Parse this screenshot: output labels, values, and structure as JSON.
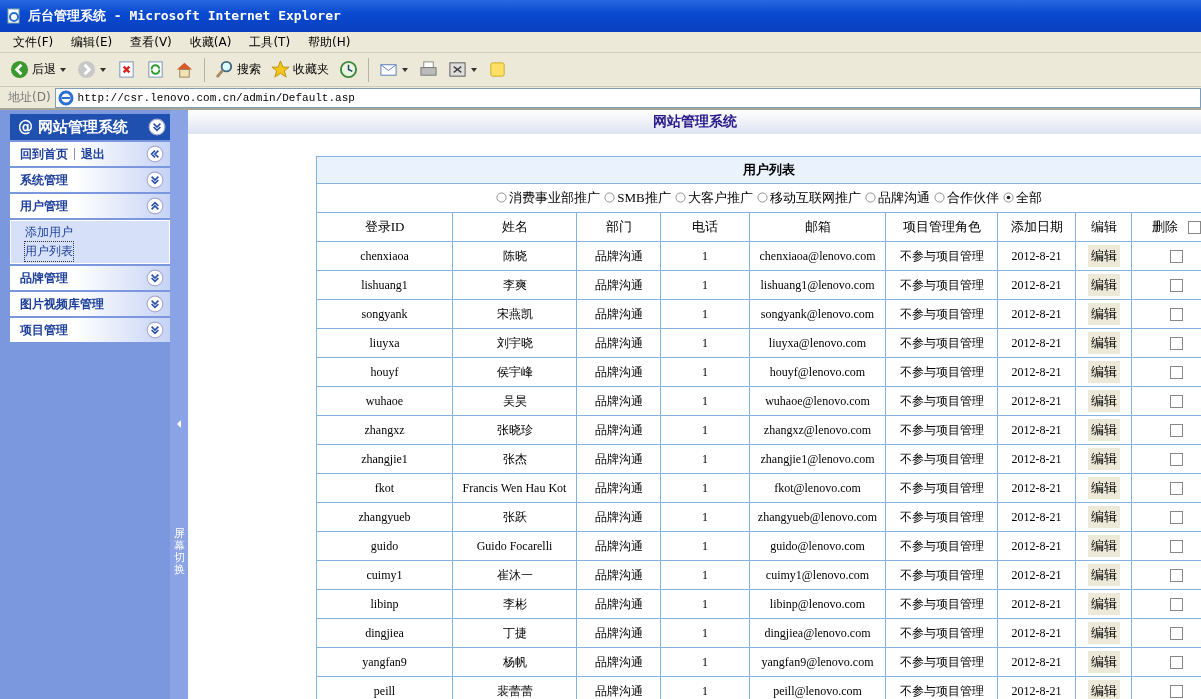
{
  "window": {
    "title": "后台管理系统 - Microsoft Internet Explorer"
  },
  "menu": [
    "文件(F)",
    "编辑(E)",
    "查看(V)",
    "收藏(A)",
    "工具(T)",
    "帮助(H)"
  ],
  "toolbar": [
    {
      "kind": "back",
      "label": "后退",
      "dropdown": true
    },
    {
      "kind": "forward",
      "dropdown": true
    },
    {
      "kind": "stop",
      "dropdown": false
    },
    {
      "kind": "refresh",
      "dropdown": false
    },
    {
      "kind": "home",
      "dropdown": false
    },
    {
      "kind": "separator"
    },
    {
      "kind": "search",
      "label": "搜索",
      "dropdown": false
    },
    {
      "kind": "favorites",
      "label": "收藏夹",
      "dropdown": false
    },
    {
      "kind": "history",
      "dropdown": false
    },
    {
      "kind": "separator"
    },
    {
      "kind": "mail",
      "dropdown": true
    },
    {
      "kind": "print",
      "dropdown": false
    },
    {
      "kind": "edit",
      "dropdown": true
    },
    {
      "kind": "note",
      "dropdown": false
    }
  ],
  "address": {
    "label": "地址(D)",
    "value": "http://csr.lenovo.com.cn/admin/Default.asp"
  },
  "sidebar": {
    "mark": "@",
    "title": "网站管理系统",
    "links": [
      "回到首页",
      "退出"
    ],
    "groups": [
      {
        "label": "系统管理",
        "expanded": false
      },
      {
        "label": "用户管理",
        "expanded": true,
        "children": [
          {
            "label": "添加用户",
            "selected": false
          },
          {
            "label": "用户列表",
            "selected": true
          }
        ]
      },
      {
        "label": "品牌管理",
        "expanded": false
      },
      {
        "label": "图片视频库管理",
        "expanded": false
      },
      {
        "label": "项目管理",
        "expanded": false
      }
    ]
  },
  "splitter": {
    "label": "屏幕切换"
  },
  "header": {
    "title": "网站管理系统"
  },
  "table": {
    "title": "用户列表",
    "filters": [
      {
        "label": "消费事业部推广",
        "selected": false
      },
      {
        "label": "SMB推广",
        "selected": false
      },
      {
        "label": "大客户推广",
        "selected": false
      },
      {
        "label": "移动互联网推广",
        "selected": false
      },
      {
        "label": "品牌沟通",
        "selected": false
      },
      {
        "label": "合作伙伴",
        "selected": false
      },
      {
        "label": "全部",
        "selected": true
      }
    ],
    "columns": [
      "登录ID",
      "姓名",
      "部门",
      "电话",
      "邮箱",
      "项目管理角色",
      "添加日期",
      "编辑",
      "删除"
    ],
    "select_all_checked": false,
    "rows": [
      {
        "login_id": "chenxiaoa",
        "name": "陈晓",
        "department": "品牌沟通",
        "phone": "1",
        "email": "chenxiaoa@lenovo.com",
        "role": "不参与项目管理",
        "date": "2012-8-21",
        "action": "编辑",
        "checked": false
      },
      {
        "login_id": "lishuang1",
        "name": "李爽",
        "department": "品牌沟通",
        "phone": "1",
        "email": "lishuang1@lenovo.com",
        "role": "不参与项目管理",
        "date": "2012-8-21",
        "action": "编辑",
        "checked": false
      },
      {
        "login_id": "songyank",
        "name": "宋燕凯",
        "department": "品牌沟通",
        "phone": "1",
        "email": "songyank@lenovo.com",
        "role": "不参与项目管理",
        "date": "2012-8-21",
        "action": "编辑",
        "checked": false
      },
      {
        "login_id": "liuyxa",
        "name": "刘宇晓",
        "department": "品牌沟通",
        "phone": "1",
        "email": "liuyxa@lenovo.com",
        "role": "不参与项目管理",
        "date": "2012-8-21",
        "action": "编辑",
        "checked": false
      },
      {
        "login_id": "houyf",
        "name": "侯宇峰",
        "department": "品牌沟通",
        "phone": "1",
        "email": "houyf@lenovo.com",
        "role": "不参与项目管理",
        "date": "2012-8-21",
        "action": "编辑",
        "checked": false
      },
      {
        "login_id": "wuhaoe",
        "name": "吴昊",
        "department": "品牌沟通",
        "phone": "1",
        "email": "wuhaoe@lenovo.com",
        "role": "不参与项目管理",
        "date": "2012-8-21",
        "action": "编辑",
        "checked": false
      },
      {
        "login_id": "zhangxz",
        "name": "张晓珍",
        "department": "品牌沟通",
        "phone": "1",
        "email": "zhangxz@lenovo.com",
        "role": "不参与项目管理",
        "date": "2012-8-21",
        "action": "编辑",
        "checked": false
      },
      {
        "login_id": "zhangjie1",
        "name": "张杰",
        "department": "品牌沟通",
        "phone": "1",
        "email": "zhangjie1@lenovo.com",
        "role": "不参与项目管理",
        "date": "2012-8-21",
        "action": "编辑",
        "checked": false
      },
      {
        "login_id": "fkot",
        "name": "Francis Wen Hau Kot",
        "department": "品牌沟通",
        "phone": "1",
        "email": "fkot@lenovo.com",
        "role": "不参与项目管理",
        "date": "2012-8-21",
        "action": "编辑",
        "checked": false
      },
      {
        "login_id": "zhangyueb",
        "name": "张跃",
        "department": "品牌沟通",
        "phone": "1",
        "email": "zhangyueb@lenovo.com",
        "role": "不参与项目管理",
        "date": "2012-8-21",
        "action": "编辑",
        "checked": false
      },
      {
        "login_id": "guido",
        "name": "Guido Focarelli",
        "department": "品牌沟通",
        "phone": "1",
        "email": "guido@lenovo.com",
        "role": "不参与项目管理",
        "date": "2012-8-21",
        "action": "编辑",
        "checked": false
      },
      {
        "login_id": "cuimy1",
        "name": "崔沐一",
        "department": "品牌沟通",
        "phone": "1",
        "email": "cuimy1@lenovo.com",
        "role": "不参与项目管理",
        "date": "2012-8-21",
        "action": "编辑",
        "checked": false
      },
      {
        "login_id": "libinp",
        "name": "李彬",
        "department": "品牌沟通",
        "phone": "1",
        "email": "libinp@lenovo.com",
        "role": "不参与项目管理",
        "date": "2012-8-21",
        "action": "编辑",
        "checked": false
      },
      {
        "login_id": "dingjiea",
        "name": "丁捷",
        "department": "品牌沟通",
        "phone": "1",
        "email": "dingjiea@lenovo.com",
        "role": "不参与项目管理",
        "date": "2012-8-21",
        "action": "编辑",
        "checked": false
      },
      {
        "login_id": "yangfan9",
        "name": "杨帆",
        "department": "品牌沟通",
        "phone": "1",
        "email": "yangfan9@lenovo.com",
        "role": "不参与项目管理",
        "date": "2012-8-21",
        "action": "编辑",
        "checked": false
      },
      {
        "login_id": "peill",
        "name": "裴蕾蕾",
        "department": "品牌沟通",
        "phone": "1",
        "email": "peill@lenovo.com",
        "role": "不参与项目管理",
        "date": "2012-8-21",
        "action": "编辑",
        "checked": false
      }
    ]
  }
}
